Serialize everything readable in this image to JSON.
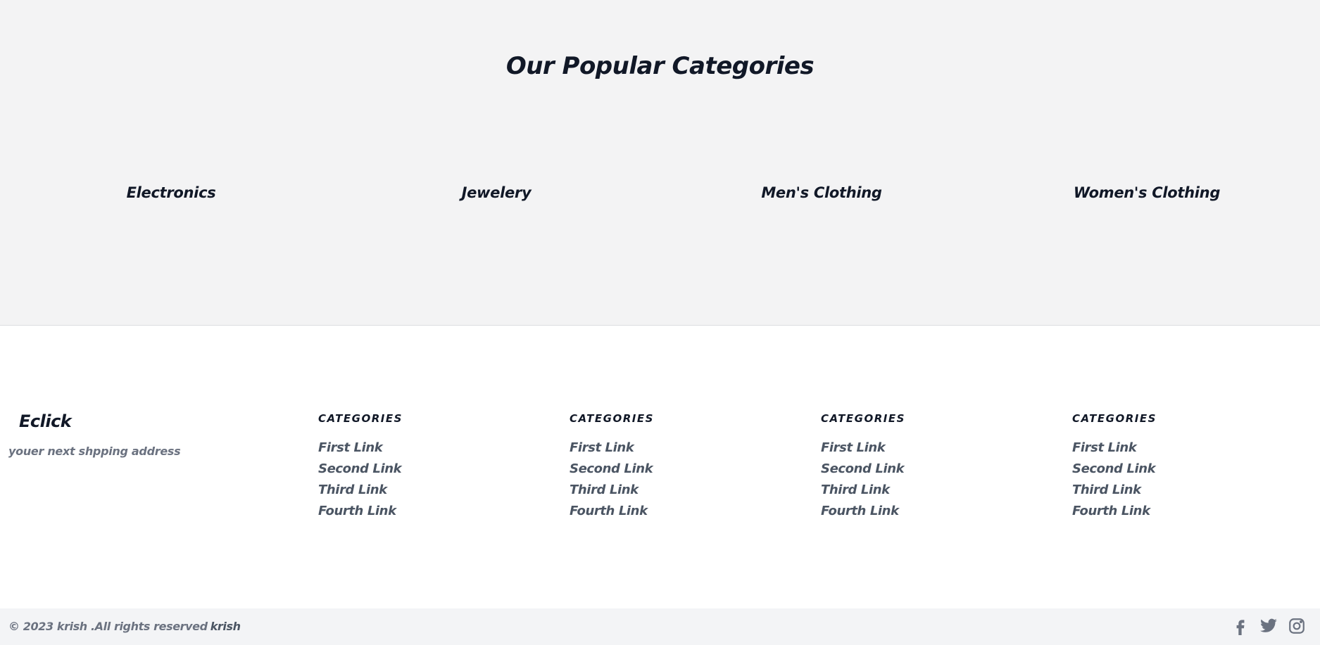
{
  "popular": {
    "title": "Our Popular Categories",
    "categories": [
      "Electronics",
      "Jewelery",
      "Men's Clothing",
      "Women's Clothing"
    ]
  },
  "footer": {
    "brand": "Eclick",
    "tagline": "youer next shpping address",
    "columns": [
      {
        "title": "CATEGORIES",
        "links": [
          "First Link",
          "Second Link",
          "Third Link",
          "Fourth Link"
        ]
      },
      {
        "title": "CATEGORIES",
        "links": [
          "First Link",
          "Second Link",
          "Third Link",
          "Fourth Link"
        ]
      },
      {
        "title": "CATEGORIES",
        "links": [
          "First Link",
          "Second Link",
          "Third Link",
          "Fourth Link"
        ]
      },
      {
        "title": "CATEGORIES",
        "links": [
          "First Link",
          "Second Link",
          "Third Link",
          "Fourth Link"
        ]
      }
    ],
    "copyright": "© 2023 krish .All rights reserved",
    "owner": "krish",
    "social_icons": [
      "facebook-icon",
      "twitter-icon",
      "instagram-icon"
    ]
  },
  "colors": {
    "section_bg": "#f3f3f4",
    "bottom_bar_bg": "#f3f4f6",
    "heading": "#111827",
    "link": "#4b5563",
    "muted": "#6b7280"
  }
}
